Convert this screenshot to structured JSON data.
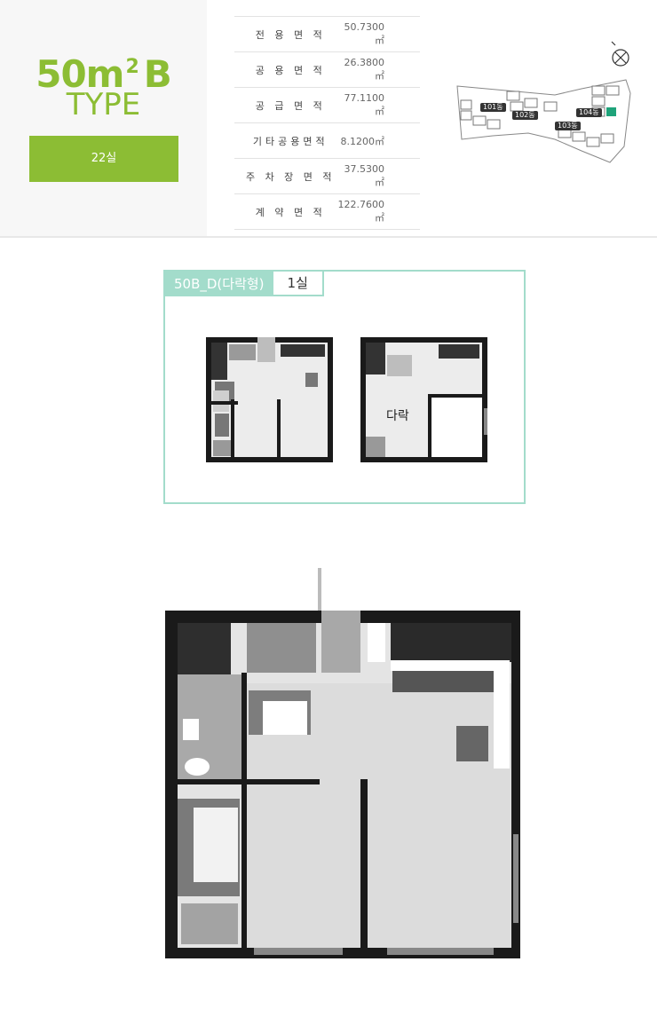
{
  "header": {
    "title": "50m",
    "title_sup": "2",
    "title_suffix": "B",
    "subtitle": "TYPE",
    "units": "22실"
  },
  "areas": [
    {
      "label": "전 용 면 적",
      "value": "50.7300㎡"
    },
    {
      "label": "공 용 면 적",
      "value": "26.3800㎡"
    },
    {
      "label": "공 급 면 적",
      "value": "77.1100㎡"
    },
    {
      "label": "기타공용면적",
      "value": "8.1200㎡"
    },
    {
      "label": "주 차 장 면 적",
      "value": "37.5300㎡"
    },
    {
      "label": "계 약 면 적",
      "value": "122.7600㎡"
    }
  ],
  "site_plan": {
    "buildings": [
      "101동",
      "102동",
      "103동",
      "104동"
    ],
    "north_mark": "N",
    "highlight_color": "#1fa37a"
  },
  "variant": {
    "name": "50B_D(다락형)",
    "count": "1실",
    "loft_label": "다락"
  },
  "colors": {
    "accent": "#8cbd34",
    "mint": "#a3dccb"
  }
}
